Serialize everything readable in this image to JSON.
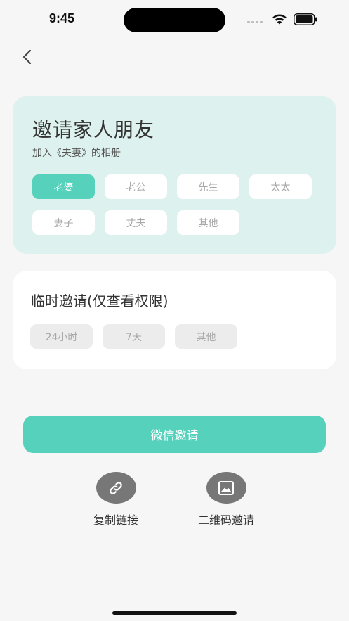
{
  "status_bar": {
    "time": "9:45"
  },
  "header": {
    "back_icon": "chevron-left-icon"
  },
  "invite_card": {
    "title": "邀请家人朋友",
    "subtitle": "加入《夫妻》的相册",
    "roles": [
      {
        "label": "老婆",
        "selected": true
      },
      {
        "label": "老公",
        "selected": false
      },
      {
        "label": "先生",
        "selected": false
      },
      {
        "label": "太太",
        "selected": false
      },
      {
        "label": "妻子",
        "selected": false
      },
      {
        "label": "丈夫",
        "selected": false
      },
      {
        "label": "其他",
        "selected": false
      }
    ]
  },
  "temp_card": {
    "title": "临时邀请(仅查看权限)",
    "options": [
      {
        "label": "24小时"
      },
      {
        "label": "7天"
      },
      {
        "label": "其他"
      }
    ]
  },
  "actions": {
    "wechat_label": "微信邀请",
    "copy_link_label": "复制链接",
    "copy_link_icon": "link-icon",
    "qr_label": "二维码邀请",
    "qr_icon": "image-icon"
  },
  "colors": {
    "accent": "#56d1bc",
    "invite_card_bg": "#ddf2ee",
    "page_bg": "#f6f6f6"
  }
}
